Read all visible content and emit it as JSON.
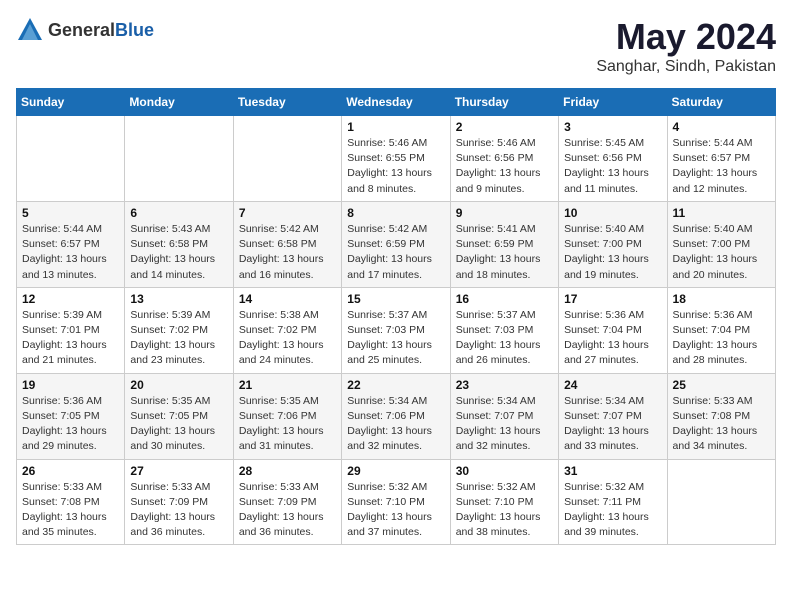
{
  "logo": {
    "text_general": "General",
    "text_blue": "Blue"
  },
  "header": {
    "title": "May 2024",
    "subtitle": "Sanghar, Sindh, Pakistan"
  },
  "weekdays": [
    "Sunday",
    "Monday",
    "Tuesday",
    "Wednesday",
    "Thursday",
    "Friday",
    "Saturday"
  ],
  "weeks": [
    [
      {
        "day": "",
        "sunrise": "",
        "sunset": "",
        "daylight": ""
      },
      {
        "day": "",
        "sunrise": "",
        "sunset": "",
        "daylight": ""
      },
      {
        "day": "",
        "sunrise": "",
        "sunset": "",
        "daylight": ""
      },
      {
        "day": "1",
        "sunrise": "Sunrise: 5:46 AM",
        "sunset": "Sunset: 6:55 PM",
        "daylight": "Daylight: 13 hours and 8 minutes."
      },
      {
        "day": "2",
        "sunrise": "Sunrise: 5:46 AM",
        "sunset": "Sunset: 6:56 PM",
        "daylight": "Daylight: 13 hours and 9 minutes."
      },
      {
        "day": "3",
        "sunrise": "Sunrise: 5:45 AM",
        "sunset": "Sunset: 6:56 PM",
        "daylight": "Daylight: 13 hours and 11 minutes."
      },
      {
        "day": "4",
        "sunrise": "Sunrise: 5:44 AM",
        "sunset": "Sunset: 6:57 PM",
        "daylight": "Daylight: 13 hours and 12 minutes."
      }
    ],
    [
      {
        "day": "5",
        "sunrise": "Sunrise: 5:44 AM",
        "sunset": "Sunset: 6:57 PM",
        "daylight": "Daylight: 13 hours and 13 minutes."
      },
      {
        "day": "6",
        "sunrise": "Sunrise: 5:43 AM",
        "sunset": "Sunset: 6:58 PM",
        "daylight": "Daylight: 13 hours and 14 minutes."
      },
      {
        "day": "7",
        "sunrise": "Sunrise: 5:42 AM",
        "sunset": "Sunset: 6:58 PM",
        "daylight": "Daylight: 13 hours and 16 minutes."
      },
      {
        "day": "8",
        "sunrise": "Sunrise: 5:42 AM",
        "sunset": "Sunset: 6:59 PM",
        "daylight": "Daylight: 13 hours and 17 minutes."
      },
      {
        "day": "9",
        "sunrise": "Sunrise: 5:41 AM",
        "sunset": "Sunset: 6:59 PM",
        "daylight": "Daylight: 13 hours and 18 minutes."
      },
      {
        "day": "10",
        "sunrise": "Sunrise: 5:40 AM",
        "sunset": "Sunset: 7:00 PM",
        "daylight": "Daylight: 13 hours and 19 minutes."
      },
      {
        "day": "11",
        "sunrise": "Sunrise: 5:40 AM",
        "sunset": "Sunset: 7:00 PM",
        "daylight": "Daylight: 13 hours and 20 minutes."
      }
    ],
    [
      {
        "day": "12",
        "sunrise": "Sunrise: 5:39 AM",
        "sunset": "Sunset: 7:01 PM",
        "daylight": "Daylight: 13 hours and 21 minutes."
      },
      {
        "day": "13",
        "sunrise": "Sunrise: 5:39 AM",
        "sunset": "Sunset: 7:02 PM",
        "daylight": "Daylight: 13 hours and 23 minutes."
      },
      {
        "day": "14",
        "sunrise": "Sunrise: 5:38 AM",
        "sunset": "Sunset: 7:02 PM",
        "daylight": "Daylight: 13 hours and 24 minutes."
      },
      {
        "day": "15",
        "sunrise": "Sunrise: 5:37 AM",
        "sunset": "Sunset: 7:03 PM",
        "daylight": "Daylight: 13 hours and 25 minutes."
      },
      {
        "day": "16",
        "sunrise": "Sunrise: 5:37 AM",
        "sunset": "Sunset: 7:03 PM",
        "daylight": "Daylight: 13 hours and 26 minutes."
      },
      {
        "day": "17",
        "sunrise": "Sunrise: 5:36 AM",
        "sunset": "Sunset: 7:04 PM",
        "daylight": "Daylight: 13 hours and 27 minutes."
      },
      {
        "day": "18",
        "sunrise": "Sunrise: 5:36 AM",
        "sunset": "Sunset: 7:04 PM",
        "daylight": "Daylight: 13 hours and 28 minutes."
      }
    ],
    [
      {
        "day": "19",
        "sunrise": "Sunrise: 5:36 AM",
        "sunset": "Sunset: 7:05 PM",
        "daylight": "Daylight: 13 hours and 29 minutes."
      },
      {
        "day": "20",
        "sunrise": "Sunrise: 5:35 AM",
        "sunset": "Sunset: 7:05 PM",
        "daylight": "Daylight: 13 hours and 30 minutes."
      },
      {
        "day": "21",
        "sunrise": "Sunrise: 5:35 AM",
        "sunset": "Sunset: 7:06 PM",
        "daylight": "Daylight: 13 hours and 31 minutes."
      },
      {
        "day": "22",
        "sunrise": "Sunrise: 5:34 AM",
        "sunset": "Sunset: 7:06 PM",
        "daylight": "Daylight: 13 hours and 32 minutes."
      },
      {
        "day": "23",
        "sunrise": "Sunrise: 5:34 AM",
        "sunset": "Sunset: 7:07 PM",
        "daylight": "Daylight: 13 hours and 32 minutes."
      },
      {
        "day": "24",
        "sunrise": "Sunrise: 5:34 AM",
        "sunset": "Sunset: 7:07 PM",
        "daylight": "Daylight: 13 hours and 33 minutes."
      },
      {
        "day": "25",
        "sunrise": "Sunrise: 5:33 AM",
        "sunset": "Sunset: 7:08 PM",
        "daylight": "Daylight: 13 hours and 34 minutes."
      }
    ],
    [
      {
        "day": "26",
        "sunrise": "Sunrise: 5:33 AM",
        "sunset": "Sunset: 7:08 PM",
        "daylight": "Daylight: 13 hours and 35 minutes."
      },
      {
        "day": "27",
        "sunrise": "Sunrise: 5:33 AM",
        "sunset": "Sunset: 7:09 PM",
        "daylight": "Daylight: 13 hours and 36 minutes."
      },
      {
        "day": "28",
        "sunrise": "Sunrise: 5:33 AM",
        "sunset": "Sunset: 7:09 PM",
        "daylight": "Daylight: 13 hours and 36 minutes."
      },
      {
        "day": "29",
        "sunrise": "Sunrise: 5:32 AM",
        "sunset": "Sunset: 7:10 PM",
        "daylight": "Daylight: 13 hours and 37 minutes."
      },
      {
        "day": "30",
        "sunrise": "Sunrise: 5:32 AM",
        "sunset": "Sunset: 7:10 PM",
        "daylight": "Daylight: 13 hours and 38 minutes."
      },
      {
        "day": "31",
        "sunrise": "Sunrise: 5:32 AM",
        "sunset": "Sunset: 7:11 PM",
        "daylight": "Daylight: 13 hours and 39 minutes."
      },
      {
        "day": "",
        "sunrise": "",
        "sunset": "",
        "daylight": ""
      }
    ]
  ]
}
